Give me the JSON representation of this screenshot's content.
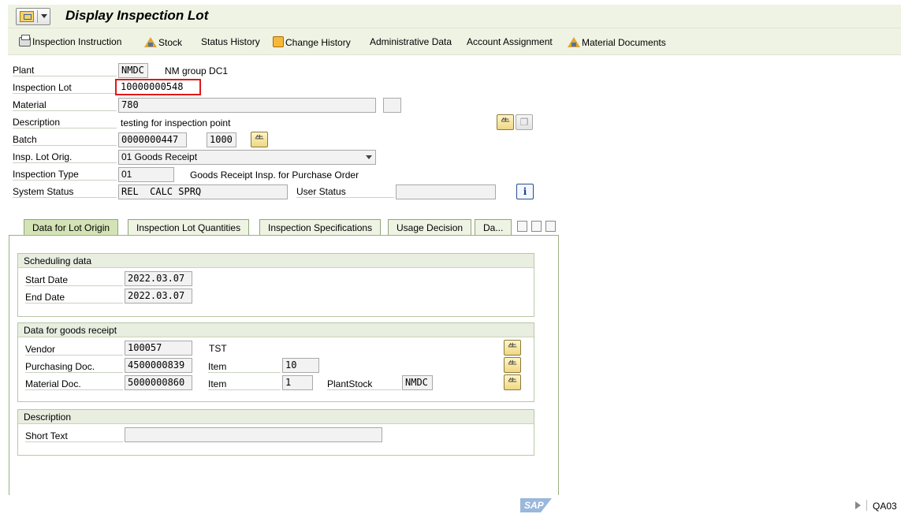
{
  "title": "Display Inspection Lot",
  "toolbar": {
    "inspection_instruction": "Inspection Instruction",
    "stock": "Stock",
    "status_history": "Status History",
    "change_history": "Change History",
    "administrative_data": "Administrative Data",
    "account_assignment": "Account Assignment",
    "material_documents": "Material Documents"
  },
  "header": {
    "plant_label": "Plant",
    "plant_value": "NMDC",
    "plant_desc": "NM group DC1",
    "inspection_lot_label": "Inspection Lot",
    "inspection_lot_value": "10000000548",
    "material_label": "Material",
    "material_value": "780",
    "description_label": "Description",
    "description_value": "testing for inspection point",
    "batch_label": "Batch",
    "batch_value": "0000000447",
    "batch_plant": "1000",
    "insp_lot_orig_label": "Insp. Lot Orig.",
    "insp_lot_orig_value": "01 Goods Receipt",
    "inspection_type_label": "Inspection Type",
    "inspection_type_value": "01",
    "inspection_type_desc": "Goods Receipt Insp. for Purchase Order",
    "system_status_label": "System Status",
    "system_status_value": "REL  CALC SPRQ",
    "user_status_label": "User Status",
    "user_status_value": ""
  },
  "tabs": [
    {
      "label": "Data for Lot Origin",
      "active": true
    },
    {
      "label": "Inspection Lot Quantities",
      "active": false
    },
    {
      "label": "Inspection Specifications",
      "active": false
    },
    {
      "label": "Usage Decision",
      "active": false
    },
    {
      "label": "Da...",
      "active": false
    }
  ],
  "scheduling": {
    "title": "Scheduling data",
    "start_date_label": "Start Date",
    "start_date": "2022.03.07",
    "end_date_label": "End Date",
    "end_date": "2022.03.07"
  },
  "goods_receipt": {
    "title": "Data for goods receipt",
    "vendor_label": "Vendor",
    "vendor_value": "100057",
    "vendor_name": "TST",
    "purchasing_doc_label": "Purchasing Doc.",
    "purchasing_doc_value": "4500000839",
    "item_label": "Item",
    "purchasing_item": "10",
    "material_doc_label": "Material Doc.",
    "material_doc_value": "5000000860",
    "material_doc_item": "1",
    "plant_stock_label": "PlantStock",
    "plant_stock_value": "NMDC"
  },
  "description_group": {
    "title": "Description",
    "short_text_label": "Short Text",
    "short_text_value": ""
  },
  "footer": {
    "logo": "SAP",
    "transaction_code": "QA03"
  },
  "colors": {
    "toolbar_bg": "#eef3e4",
    "active_tab": "#d4e3b6",
    "highlight_box": "#e01818"
  }
}
